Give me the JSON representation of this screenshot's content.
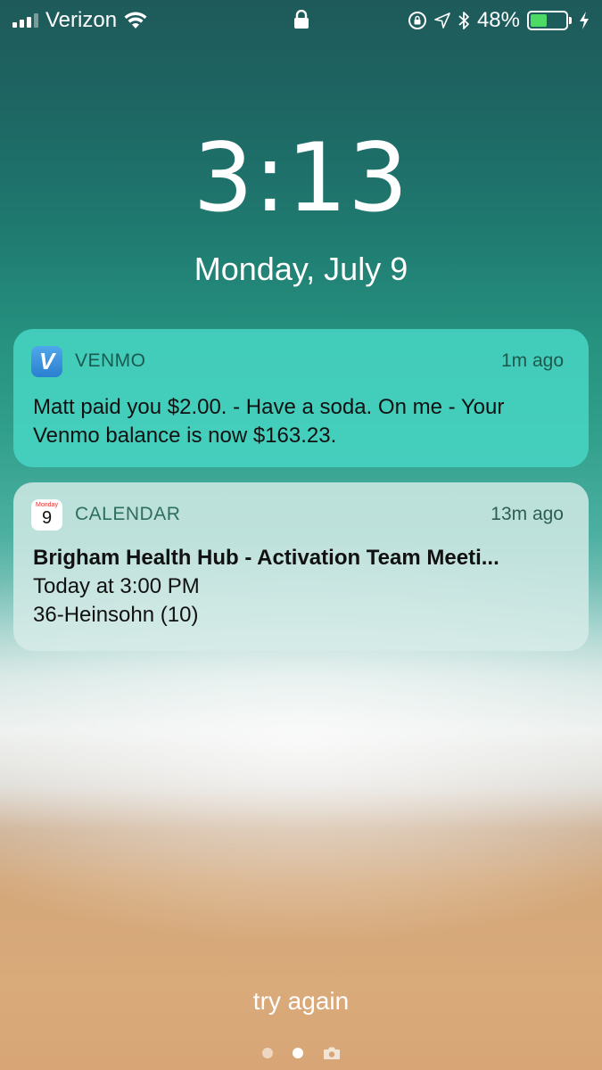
{
  "status_bar": {
    "carrier": "Verizon",
    "battery_percent_label": "48%",
    "battery_level": 0.48,
    "signal_bars": 3,
    "icons": [
      "signal-icon",
      "wifi-icon",
      "lock-icon",
      "rotation-lock-icon",
      "location-icon",
      "bluetooth-icon",
      "battery-icon",
      "charging-icon"
    ]
  },
  "lock_screen": {
    "time": "3:13",
    "date": "Monday, July 9"
  },
  "notifications": [
    {
      "app": "VENMO",
      "time_ago": "1m ago",
      "icon": "venmo-icon",
      "icon_letter": "V",
      "message": "Matt paid you $2.00. - Have a soda. On me - Your Venmo balance is now $163.23."
    },
    {
      "app": "CALENDAR",
      "time_ago": "13m ago",
      "icon": "calendar-icon",
      "icon_month": "Monday",
      "icon_day": "9",
      "title": "Brigham Health Hub - Activation Team Meeti...",
      "line1": "Today at 3:00 PM",
      "line2": "36-Heinsohn (10)"
    }
  ],
  "footer": {
    "hint": "try again",
    "pages": 2,
    "active_page": 2
  },
  "colors": {
    "battery_fill": "#4cd964",
    "venmo_card": "#48d6c4",
    "venmo_icon": "#3d95e0",
    "calendar_red": "#e0302c"
  }
}
